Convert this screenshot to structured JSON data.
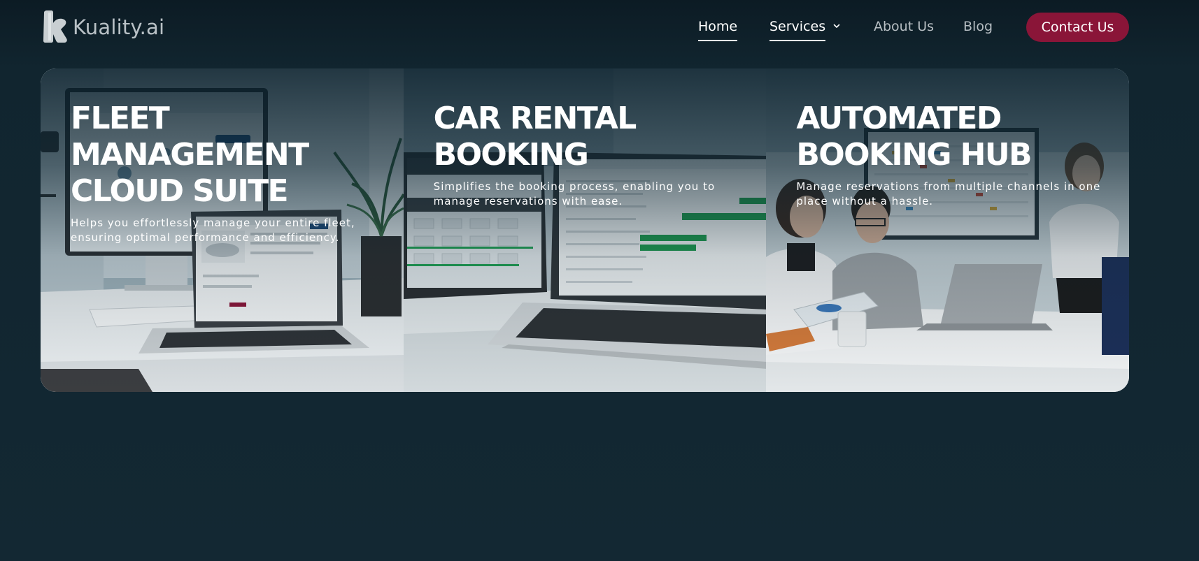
{
  "brand": {
    "name": "Kuality.ai"
  },
  "nav": {
    "items": [
      {
        "label": "Home",
        "active": true
      },
      {
        "label": "Services",
        "active": true,
        "has_dropdown": true
      },
      {
        "label": "About Us",
        "active": false
      },
      {
        "label": "Blog",
        "active": false
      }
    ],
    "contact_label": "Contact Us"
  },
  "hero": {
    "cards": [
      {
        "title": "FLEET MANAGEMENT CLOUD SUITE",
        "description": "Helps you effortlessly manage your entire fleet, ensuring optimal performance and efficiency.",
        "image": "laptop-and-monitor-fleet-dashboard"
      },
      {
        "title": "CAR RENTAL BOOKING",
        "description": "Simplifies the booking process, enabling you to manage reservations with ease.",
        "image": "laptop-booking-timeline"
      },
      {
        "title": "AUTOMATED BOOKING HUB",
        "description": "Manage reservations from multiple channels in one place without a hassle.",
        "image": "team-meeting-room"
      }
    ]
  },
  "colors": {
    "background": "#11242f",
    "accent": "#8a1538",
    "text": "#ffffff",
    "nav_muted": "#b7bec3"
  }
}
